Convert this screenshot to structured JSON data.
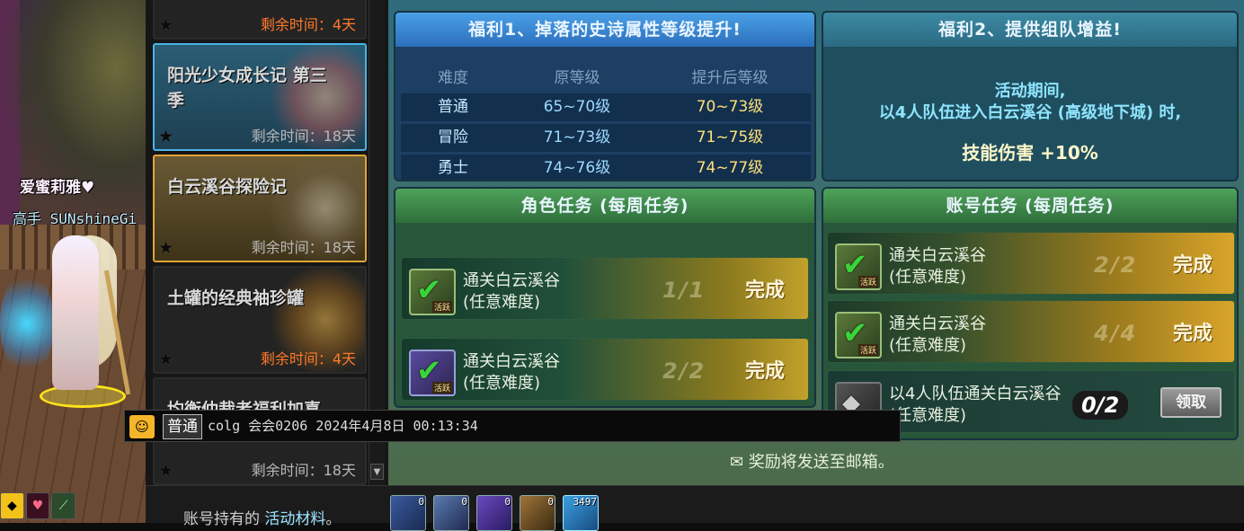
{
  "scene": {
    "player_name": "爱蜜莉雅♥",
    "player_title": "高手",
    "player_tag": "SUNshineGi"
  },
  "event_list": {
    "items": [
      {
        "title": "",
        "remaining": "剩余时间：4天",
        "remaining_color": "#ff7a2a",
        "state": "normal"
      },
      {
        "title": "阳光少女成长记 第三季",
        "remaining": "剩余时间：18天",
        "remaining_color": "#b8b8b8",
        "state": "selected-blue"
      },
      {
        "title": "白云溪谷探险记",
        "remaining": "剩余时间：18天",
        "remaining_color": "#b8b8b8",
        "state": "selected-gold"
      },
      {
        "title": "土罐的经典袖珍罐",
        "remaining": "剩余时间：4天",
        "remaining_color": "#ff7a2a",
        "state": "normal"
      },
      {
        "title": "均衡仲裁者福利加喜",
        "remaining": "剩余时间：18天",
        "remaining_color": "#b8b8b8",
        "state": "normal"
      }
    ]
  },
  "benefit1": {
    "title": "福利1、掉落的史诗属性等级提升!",
    "headers": [
      "难度",
      "原等级",
      "提升后等级"
    ],
    "rows": [
      [
        "普通",
        "65~70级",
        "70~73级"
      ],
      [
        "冒险",
        "71~73级",
        "71~75级"
      ],
      [
        "勇士",
        "74~76级",
        "74~77级"
      ]
    ]
  },
  "benefit2": {
    "title": "福利2、提供组队增益!",
    "line1": "活动期间,",
    "line2": "以4人队伍进入白云溪谷 (高级地下城) 时,",
    "bonus": "技能伤害 +10%"
  },
  "role_tasks": {
    "title": "角色任务 (每周任务)",
    "items": [
      {
        "line1": "通关白云溪谷",
        "line2": "(任意难度)",
        "progress": "1/1",
        "status": "完成",
        "tag": "活跃"
      },
      {
        "line1": "通关白云溪谷",
        "line2": "(任意难度)",
        "progress": "2/2",
        "status": "完成",
        "tag": "活跃"
      }
    ]
  },
  "account_tasks": {
    "title": "账号任务 (每周任务)",
    "items": [
      {
        "line1": "通关白云溪谷",
        "line2": "(任意难度)",
        "progress": "2/2",
        "status": "完成",
        "tag": "活跃"
      },
      {
        "line1": "通关白云溪谷",
        "line2": "(任意难度)",
        "progress": "4/4",
        "status": "完成",
        "tag": "活跃"
      },
      {
        "line1": "以4人队伍通关白云溪谷",
        "line2": "(任意难度)",
        "progress": "0/2",
        "status": "领取",
        "tag": ""
      }
    ]
  },
  "mail_note": "✉ 奖励将发送至邮箱。",
  "chat": {
    "channel": "普通",
    "message": "colg 会会0206 2024年4月8日 00:13:34"
  },
  "bottom": {
    "label_prefix": "账号持有的 ",
    "label_highlight": "活动材料",
    "label_suffix": "。",
    "materials": [
      {
        "count": "0"
      },
      {
        "count": "0"
      },
      {
        "count": "0"
      },
      {
        "count": "0"
      },
      {
        "count": "3497"
      }
    ]
  },
  "colors": {
    "accent_gold": "#e1a634",
    "accent_blue": "#49b4e6",
    "remaining_red": "#ff7a2a"
  }
}
